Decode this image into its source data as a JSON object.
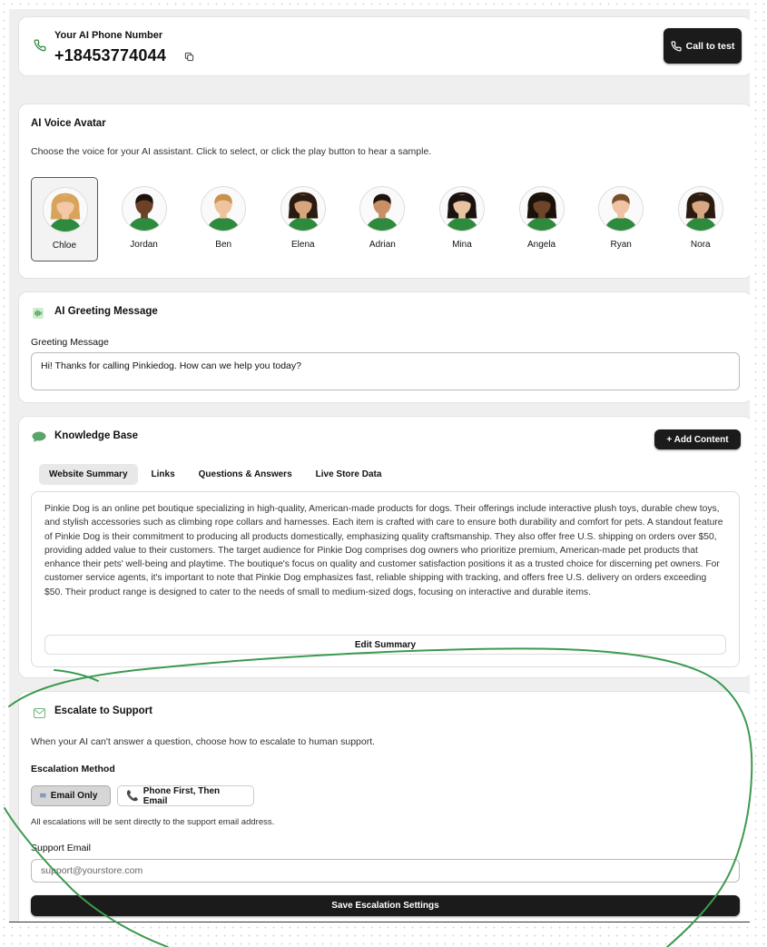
{
  "phone": {
    "label": "Your AI Phone Number",
    "number": "+18453774044",
    "call_button": "Call to test",
    "icon": "phone-icon"
  },
  "voice": {
    "title": "AI Voice Avatar",
    "description": "Choose the voice for your AI assistant. Click to select, or click the play button to hear a sample.",
    "selected": "Chloe",
    "avatars": [
      {
        "name": "Chloe",
        "skin": "#f2c9a4",
        "hair": "#d8a45c",
        "long": true
      },
      {
        "name": "Jordan",
        "skin": "#6b4226",
        "hair": "#1c120c",
        "long": false
      },
      {
        "name": "Ben",
        "skin": "#f0c3a0",
        "hair": "#c8924e",
        "long": false
      },
      {
        "name": "Elena",
        "skin": "#d9a57c",
        "hair": "#2a1a10",
        "long": true
      },
      {
        "name": "Adrian",
        "skin": "#c98f67",
        "hair": "#1e140e",
        "long": false
      },
      {
        "name": "Mina",
        "skin": "#eac4a0",
        "hair": "#1a1210",
        "long": true
      },
      {
        "name": "Angela",
        "skin": "#6e442a",
        "hair": "#1b110b",
        "long": true
      },
      {
        "name": "Ryan",
        "skin": "#efc3a3",
        "hair": "#7a4f2a",
        "long": false
      },
      {
        "name": "Nora",
        "skin": "#d9a783",
        "hair": "#2b1a0f",
        "long": true
      }
    ]
  },
  "greeting": {
    "title": "AI Greeting Message",
    "field_label": "Greeting Message",
    "value": "Hi! Thanks for calling Pinkiedog. How can we help you today?"
  },
  "knowledge": {
    "title": "Knowledge Base",
    "add_button": "+ Add Content",
    "tabs": [
      "Website Summary",
      "Links",
      "Questions & Answers",
      "Live Store Data"
    ],
    "active_tab": "Website Summary",
    "summary": "Pinkie Dog is an online pet boutique specializing in high-quality, American-made products for dogs. Their offerings include interactive plush toys, durable chew toys, and stylish accessories such as climbing rope collars and harnesses. Each item is crafted with care to ensure both durability and comfort for pets. A standout feature of Pinkie Dog is their commitment to producing all products domestically, emphasizing quality craftsmanship. They also offer free U.S. shipping on orders over $50, providing added value to their customers. The target audience for Pinkie Dog comprises dog owners who prioritize premium, American-made pet products that enhance their pets' well-being and playtime. The boutique's focus on quality and customer satisfaction positions it as a trusted choice for discerning pet owners. For customer service agents, it's important to note that Pinkie Dog emphasizes fast, reliable shipping with tracking, and offers free U.S. delivery on orders exceeding $50. Their product range is designed to cater to the needs of small to medium-sized dogs, focusing on interactive and durable items.",
    "edit_button": "Edit Summary"
  },
  "escalate": {
    "title": "Escalate to Support",
    "description": "When your AI can't answer a question, choose how to escalate to human support.",
    "method_label": "Escalation Method",
    "options": [
      "Email Only",
      "Phone First, Then Email"
    ],
    "selected_option": "Email Only",
    "note": "All escalations will be sent directly to the support email address.",
    "email_label": "Support Email",
    "email_placeholder": "support@yourstore.com",
    "save_button": "Save Escalation Settings"
  },
  "colors": {
    "accent_green": "#2e8b3e",
    "dark_button": "#1b1b1b",
    "annotation_green": "#3c9a4f"
  }
}
